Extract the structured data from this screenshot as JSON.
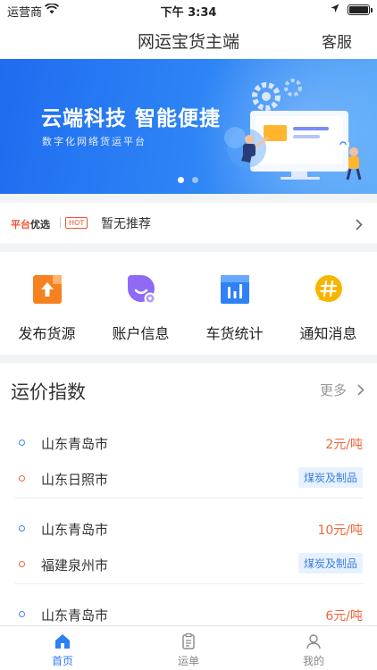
{
  "status_bar": {
    "carrier": "运营商",
    "time": "下午 3:34"
  },
  "nav": {
    "title": "网运宝货主端",
    "service_label": "客服"
  },
  "banner": {
    "headline": "云端科技 智能便捷",
    "subtitle": "数字化网络货运平台",
    "active_slide": 1,
    "total_slides": 2
  },
  "recommend": {
    "brand_part1": "平台",
    "brand_part2": "优选",
    "hot_label": "HOT",
    "text": "暂无推荐"
  },
  "quick_actions": [
    {
      "label": "发布货源",
      "icon": "publish-cargo-icon",
      "color": "#f5821f"
    },
    {
      "label": "账户信息",
      "icon": "account-info-icon",
      "color": "#8e6af5"
    },
    {
      "label": "车货统计",
      "icon": "statistics-icon",
      "color": "#2f82f5"
    },
    {
      "label": "通知消息",
      "icon": "notification-icon",
      "color": "#f7b500"
    }
  ],
  "freight_index": {
    "title": "运价指数",
    "more_label": "更多",
    "routes": [
      {
        "from": "山东青岛市",
        "to": "山东日照市",
        "price": "2元/吨",
        "category": "煤炭及制品"
      },
      {
        "from": "山东青岛市",
        "to": "福建泉州市",
        "price": "10元/吨",
        "category": "煤炭及制品"
      },
      {
        "from": "山东青岛市",
        "to": "",
        "price": "6元/吨",
        "category": ""
      }
    ]
  },
  "tabbar": [
    {
      "label": "首页",
      "icon": "home-icon",
      "active": true
    },
    {
      "label": "运单",
      "icon": "waybill-icon",
      "active": false
    },
    {
      "label": "我的",
      "icon": "profile-icon",
      "active": false
    }
  ],
  "colors": {
    "accent": "#2f7ef5",
    "price": "#f1653b",
    "hot": "#f1532e"
  }
}
